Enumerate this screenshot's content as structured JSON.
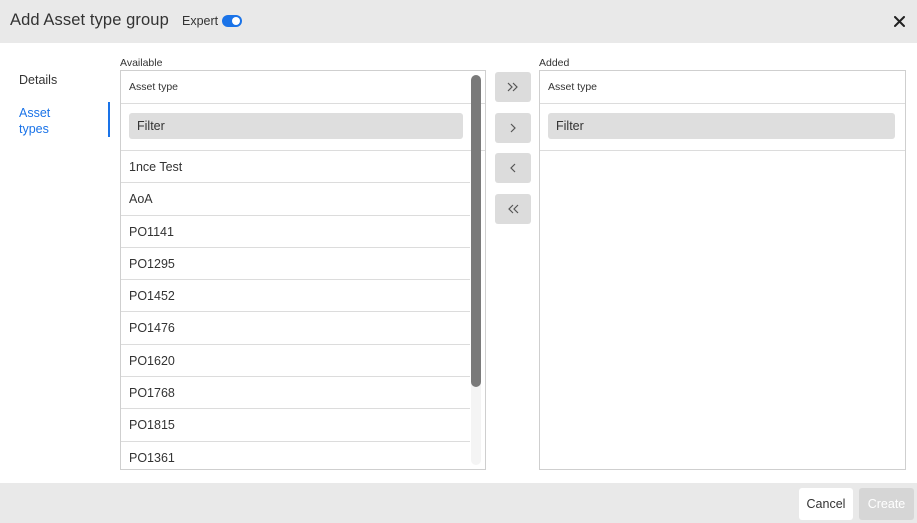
{
  "header": {
    "title": "Add Asset type group",
    "expert_label": "Expert",
    "expert_enabled": true,
    "accent_color": "#1a73e8"
  },
  "nav": {
    "items": [
      {
        "label": "Details",
        "active": false
      },
      {
        "label": "Asset types",
        "active": true
      }
    ]
  },
  "available": {
    "section_label": "Available",
    "column_header": "Asset type",
    "filter_placeholder": "Filter",
    "items": [
      "1nce Test",
      "AoA",
      "PO1141",
      "PO1295",
      "PO1452",
      "PO1476",
      "PO1620",
      "PO1768",
      "PO1815",
      "PO1361"
    ]
  },
  "added": {
    "section_label": "Added",
    "column_header": "Asset type",
    "filter_placeholder": "Filter",
    "items": []
  },
  "transfer": {
    "add_all_icon": "double-chevron-right-icon",
    "add_icon": "chevron-right-icon",
    "remove_icon": "chevron-left-icon",
    "remove_all_icon": "double-chevron-left-icon"
  },
  "footer": {
    "cancel_label": "Cancel",
    "create_label": "Create",
    "create_enabled": false
  }
}
